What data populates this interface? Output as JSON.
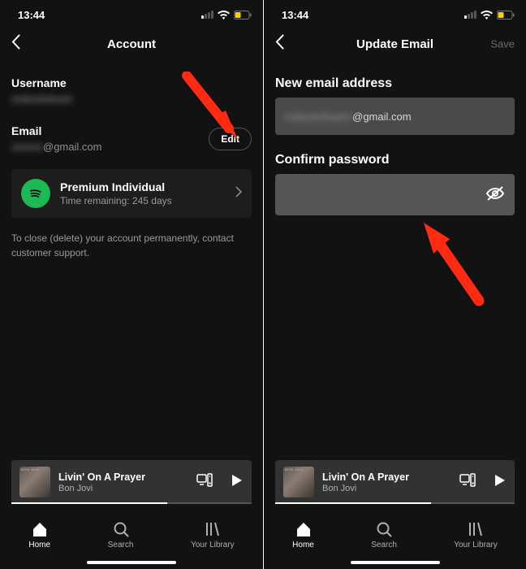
{
  "status": {
    "time": "13:44"
  },
  "left": {
    "title": "Account",
    "username_label": "Username",
    "username_value": "redacteduser",
    "email_label": "Email",
    "email_prefix": "xxxxxx",
    "email_domain": "@gmail.com",
    "edit": "Edit",
    "premium_title": "Premium Individual",
    "premium_sub": "Time remaining: 245 days",
    "close_text": "To close (delete) your account permanently, contact customer support."
  },
  "right": {
    "title": "Update Email",
    "save": "Save",
    "new_email_label": "New email address",
    "new_email_prefix": "redactedname",
    "new_email_domain": "@gmail.com",
    "confirm_label": "Confirm password"
  },
  "now_playing": {
    "track": "Livin' On A Prayer",
    "artist": "Bon Jovi"
  },
  "tabs": {
    "home": "Home",
    "search": "Search",
    "library": "Your Library"
  }
}
